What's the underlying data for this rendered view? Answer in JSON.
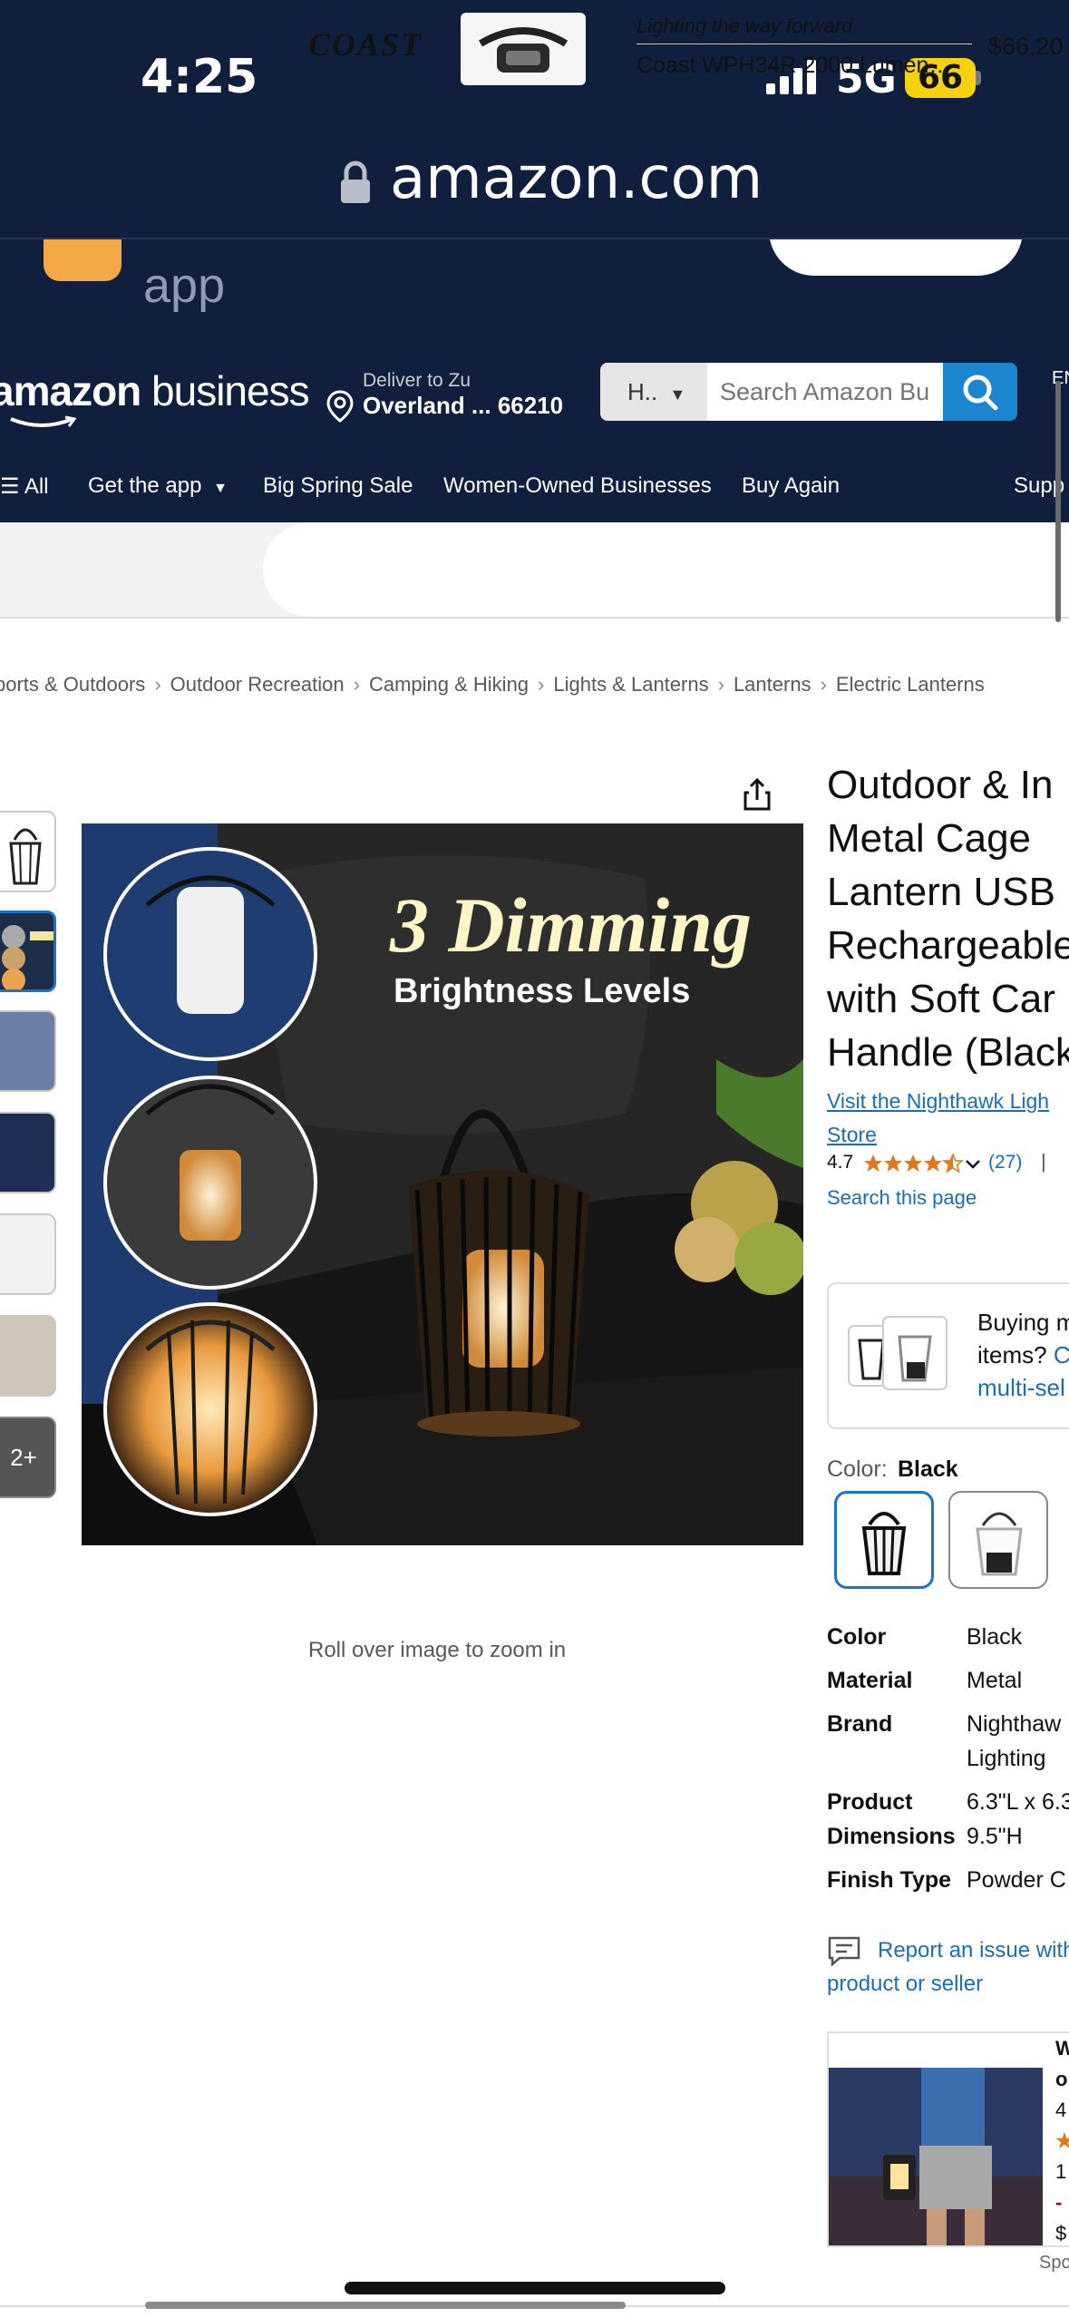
{
  "status": {
    "time": "4:25",
    "network": "5G",
    "battery": "66"
  },
  "browser": {
    "url": "amazon.com"
  },
  "app_banner": {
    "text": "app"
  },
  "header": {
    "logo_amazon": "amazon",
    "logo_business": "business",
    "deliver_to": "Deliver to Zu",
    "deliver_location": "Overland ... 66210",
    "search_category": "H..",
    "search_placeholder": "Search Amazon Bu",
    "lang": "EN"
  },
  "nav": {
    "all": "All",
    "items": [
      "Get the app",
      "Big Spring Sale",
      "Women-Owned Businesses",
      "Buy Again",
      "Supp"
    ]
  },
  "ad": {
    "brand": "COAST",
    "tagline": "Lighting the way forward",
    "title": "Coast WPH34R 2000 Lumen…",
    "price": "$66.20"
  },
  "breadcrumb": [
    "ports & Outdoors",
    "Outdoor Recreation",
    "Camping & Hiking",
    "Lights & Lanterns",
    "Lanterns",
    "Electric Lanterns"
  ],
  "gallery": {
    "more_count": "2+",
    "zoom_hint": "Roll over image to zoom in",
    "overlay_title": "3 Dimming",
    "overlay_subtitle": "Brightness Levels"
  },
  "product": {
    "title_lines": [
      "Outdoor & In",
      "Metal Cage",
      "Lantern USB",
      "Rechargeable",
      "with Soft Car",
      "Handle (Black"
    ],
    "store_link_lines": [
      "Visit the Nighthawk Ligh",
      "Store"
    ],
    "rating": "4.7",
    "rating_value": 4.7,
    "rating_count": "(27)",
    "rating_sep": "|",
    "search_page": "Search this page",
    "multi_lines": [
      "Buying m",
      "items?"
    ],
    "multi_link1": "C",
    "multi_link2": "multi-sel",
    "color_label": "Color:",
    "color_value": "Black",
    "specs": [
      {
        "key": [
          "Color"
        ],
        "value": [
          "Black"
        ]
      },
      {
        "key": [
          "Material"
        ],
        "value": [
          "Metal"
        ]
      },
      {
        "key": [
          "Brand"
        ],
        "value": [
          "Nighthaw",
          "Lighting"
        ]
      },
      {
        "key": [
          "Product",
          "Dimensions"
        ],
        "value": [
          "6.3\"L x 6.3",
          "9.5\"H"
        ]
      },
      {
        "key": [
          "Finish Type"
        ],
        "value": [
          "Powder C"
        ]
      }
    ],
    "report_lines": [
      "Report an issue with",
      "product or seller"
    ]
  },
  "sponsored": {
    "label": "Spo",
    "lines": [
      "W",
      "o",
      "4",
      "1",
      "$"
    ]
  },
  "colors": {
    "navy": "#0f1f3d",
    "link": "#1b6db3",
    "accent": "#1a73c9",
    "star": "#de7921",
    "search_btn": "#1c85d0"
  }
}
